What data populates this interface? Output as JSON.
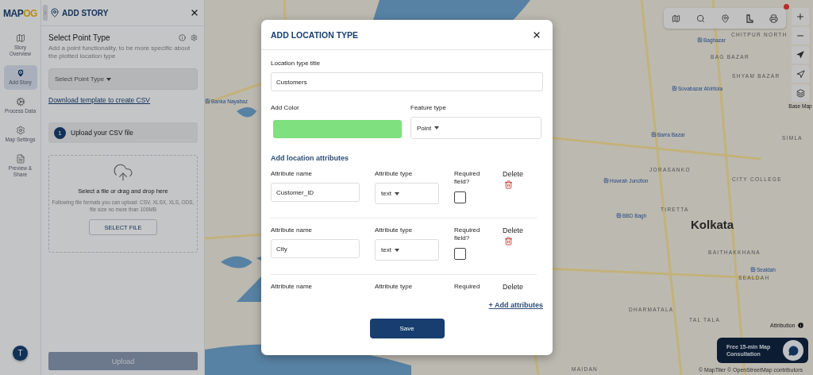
{
  "header": {
    "logo_main": "MAP",
    "logo_accent": "OG",
    "title": "ADD STORY"
  },
  "rail": [
    {
      "label": "Story Overview",
      "kind": "map",
      "selected": false
    },
    {
      "label": "Add Story",
      "kind": "pin",
      "selected": true
    },
    {
      "label": "Process Data",
      "kind": "cog",
      "selected": false
    },
    {
      "label": "Map Settings",
      "kind": "gear",
      "selected": false
    },
    {
      "label": "Preview & Share",
      "kind": "preview",
      "selected": false
    }
  ],
  "avatar": "T",
  "panel": {
    "title": "Select Point Type",
    "description": "Add a point functionality, to be more specific about the plotted location type",
    "select_placeholder": "Select Point Type",
    "template_link": "Download template to create CSV",
    "step_number": "1",
    "step_label": "Upload your CSV file",
    "drop_title": "Select a file or drag and drop here",
    "drop_hint": "Following file formats you can upload: CSV, XLSX, XLS, ODS, file size no more than 100MB",
    "select_file": "SELECT FILE",
    "upload": "Upload",
    "upload_disabled": true
  },
  "map": {
    "labels": [
      {
        "text": "Banka Nayabaz",
        "kind": "station"
      },
      {
        "text": "Baghazar",
        "kind": "station"
      },
      {
        "text": "CHITPUR NORTH",
        "kind": "district"
      },
      {
        "text": "BAG BAZAR",
        "kind": "district"
      },
      {
        "text": "SHYAM BAZAR",
        "kind": "district"
      },
      {
        "text": "Sovabazar Ahiritola",
        "kind": "station"
      },
      {
        "text": "Barra Bazar",
        "kind": "station"
      },
      {
        "text": "SIMLA",
        "kind": "district"
      },
      {
        "text": "JORASANKO",
        "kind": "district"
      },
      {
        "text": "Howrah Junction",
        "kind": "station"
      },
      {
        "text": "CITY COLLEGE",
        "kind": "district"
      },
      {
        "text": "BBD Bagh",
        "kind": "station"
      },
      {
        "text": "TIRETTA",
        "kind": "district"
      },
      {
        "text": "Kolkata",
        "kind": "city"
      },
      {
        "text": "BAITHAKKHANA",
        "kind": "district"
      },
      {
        "text": "Sealdah",
        "kind": "station"
      },
      {
        "text": "SEALDAH",
        "kind": "district"
      },
      {
        "text": "DHARMATALA",
        "kind": "district"
      },
      {
        "text": "TAL TALA",
        "kind": "district"
      },
      {
        "text": "MAIDAN",
        "kind": "district"
      }
    ],
    "base_map": "Base Map",
    "attribution": "Attribution",
    "consultation": "Free 15-min Map Consultation",
    "copyright": "© MapTiler © OpenStreetMap contributors"
  },
  "modal": {
    "title": "ADD LOCATION TYPE",
    "title_label": "Location type title",
    "title_value": "Customers",
    "color_label": "Add Color",
    "color": "#7ee07e",
    "feature_label": "Feature type",
    "feature_value": "Point",
    "section": "Add location attributes",
    "attributes": [
      {
        "name_label": "Attribute name",
        "name_value": "Customer_ID",
        "type_label": "Attribute type",
        "type_value": "text",
        "required_label": "Required field?",
        "checked": false,
        "delete_label": "Delete"
      },
      {
        "name_label": "Attribute name",
        "name_value": "City",
        "type_label": "Attribute type",
        "type_value": "text",
        "required_label": "Required field?",
        "checked": false,
        "delete_label": "Delete"
      },
      {
        "name_label": "Attribute name",
        "type_label": "Attribute type",
        "required_label": "Required",
        "delete_label": "Delete"
      }
    ],
    "add_link": "+ Add attributes",
    "save": "Save"
  }
}
